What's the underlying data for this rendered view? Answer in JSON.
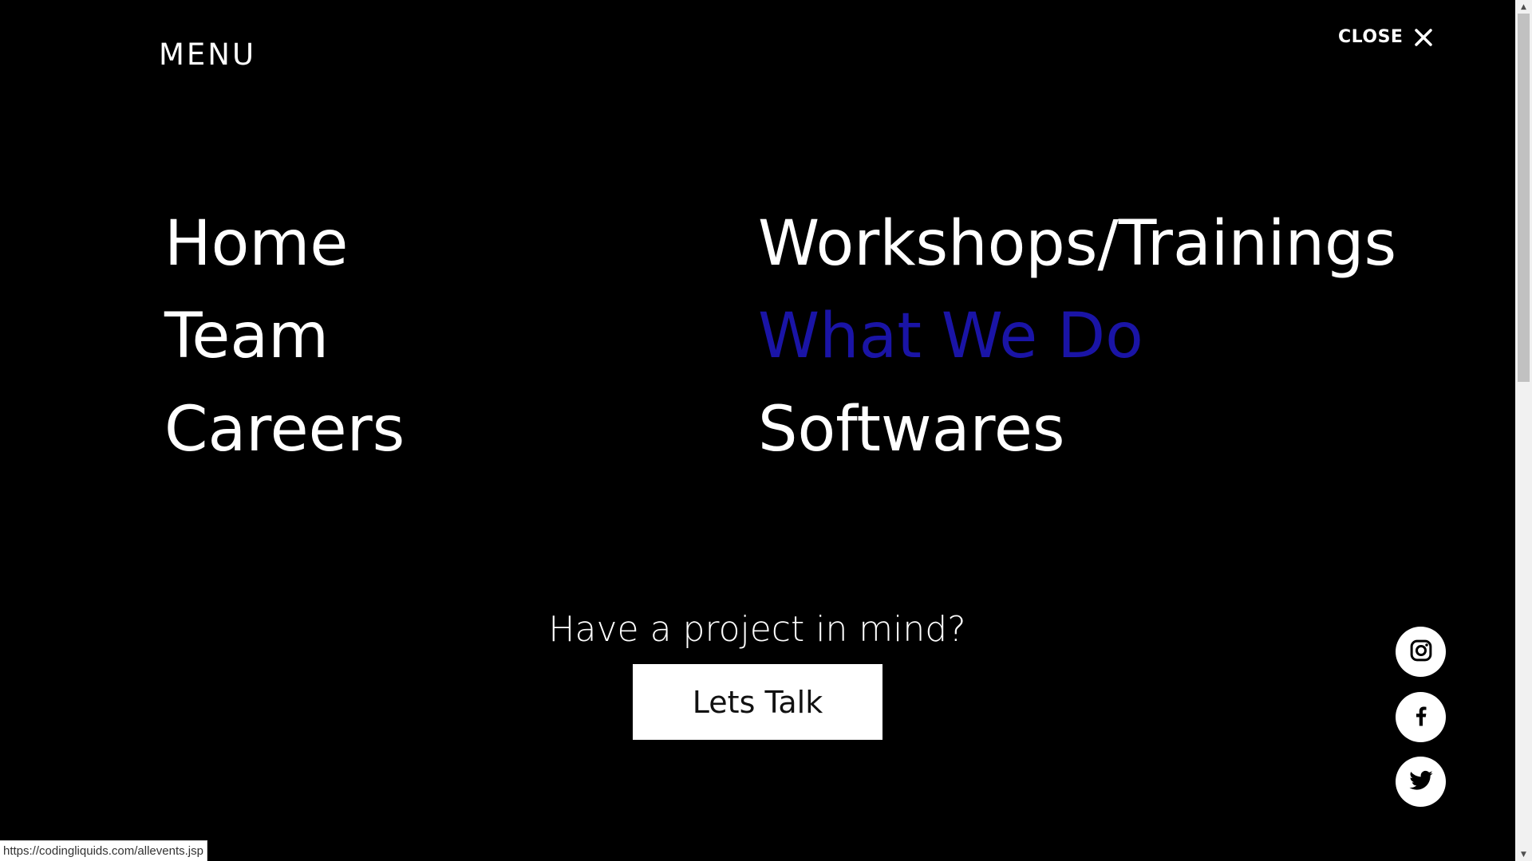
{
  "header": {
    "menu_title": "MENU",
    "close_label": "CLOSE"
  },
  "nav": {
    "home": "Home",
    "team": "Team",
    "careers": "Careers",
    "workshops": "Workshops/Trainings",
    "what_we_do": "What We Do",
    "softwares": "Softwares"
  },
  "cta": {
    "question": "Have a project in mind?",
    "button_label": "Lets Talk"
  },
  "social": [
    "instagram-icon",
    "facebook-icon",
    "twitter-icon"
  ],
  "status_bar": {
    "url": "https://codingliquids.com/allevents.jsp"
  },
  "colors": {
    "background": "#000000",
    "text": "#ffffff",
    "active_nav": "#1a14a6"
  }
}
